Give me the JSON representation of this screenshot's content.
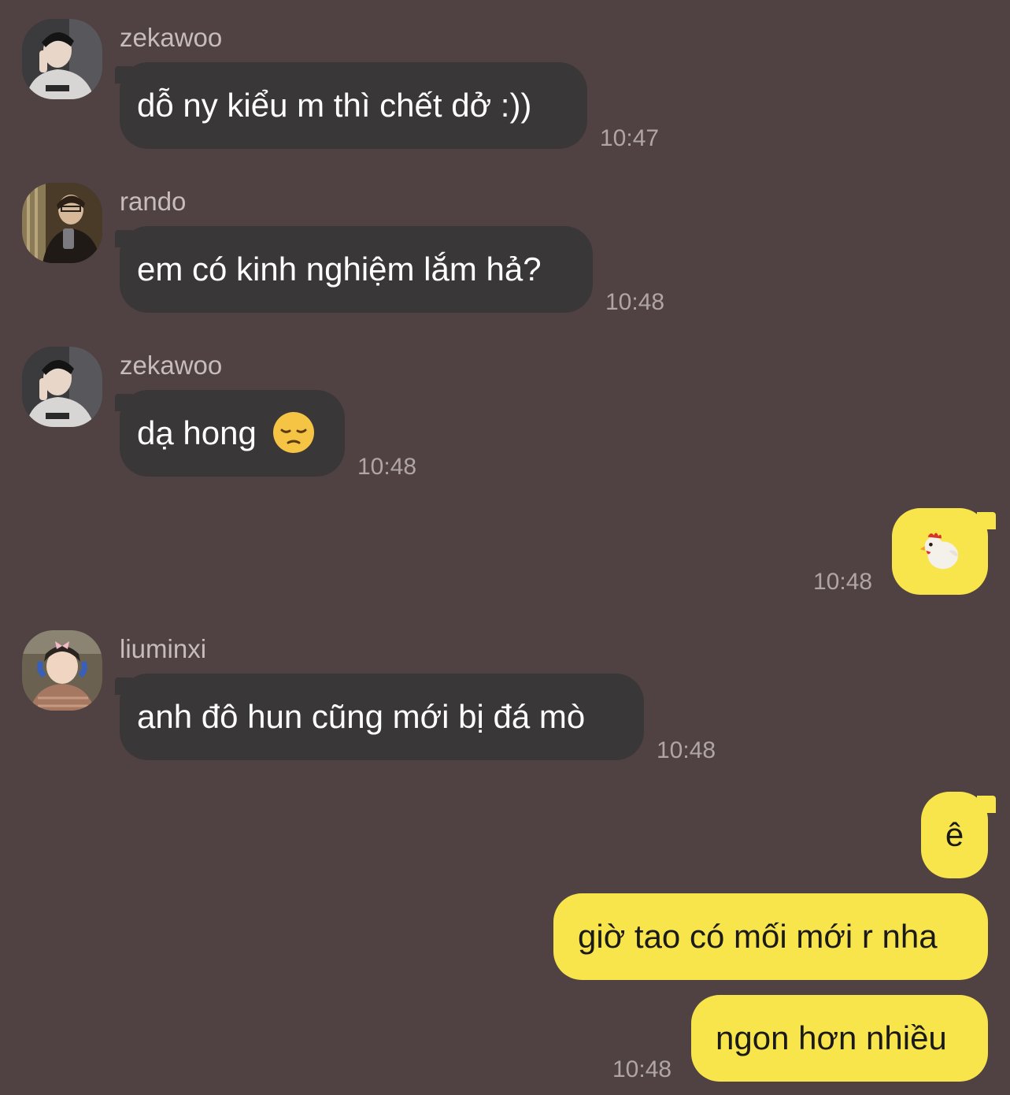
{
  "messages": [
    {
      "sender": "zekawoo",
      "text": "dỗ ny kiểu m thì chết dở :))",
      "time": "10:47",
      "avatar": "avatar-zekawoo"
    },
    {
      "sender": "rando",
      "text": "em có kinh nghiệm lắm hả?",
      "time": "10:48",
      "avatar": "avatar-rando"
    },
    {
      "sender": "zekawoo",
      "text": "dạ hong",
      "emoji": "pensive-face-emoji",
      "time": "10:48",
      "avatar": "avatar-zekawoo"
    },
    {
      "sender": "me",
      "emoji": "chicken-emoji",
      "time": "10:48"
    },
    {
      "sender": "liuminxi",
      "text": "anh đô hun cũng mới bị đá mò",
      "time": "10:48",
      "avatar": "avatar-liuminxi"
    },
    {
      "sender": "me",
      "text": "ê"
    },
    {
      "sender": "me",
      "text": "giờ tao có mối mới r nha"
    },
    {
      "sender": "me",
      "text": "ngon hơn nhiều",
      "time": "10:48"
    }
  ],
  "colors": {
    "background": "#504142",
    "incoming_bubble": "#3a3738",
    "outgoing_bubble": "#f8e44b",
    "sender_name": "#c7bcbc",
    "timestamp": "#b0a5a5"
  }
}
